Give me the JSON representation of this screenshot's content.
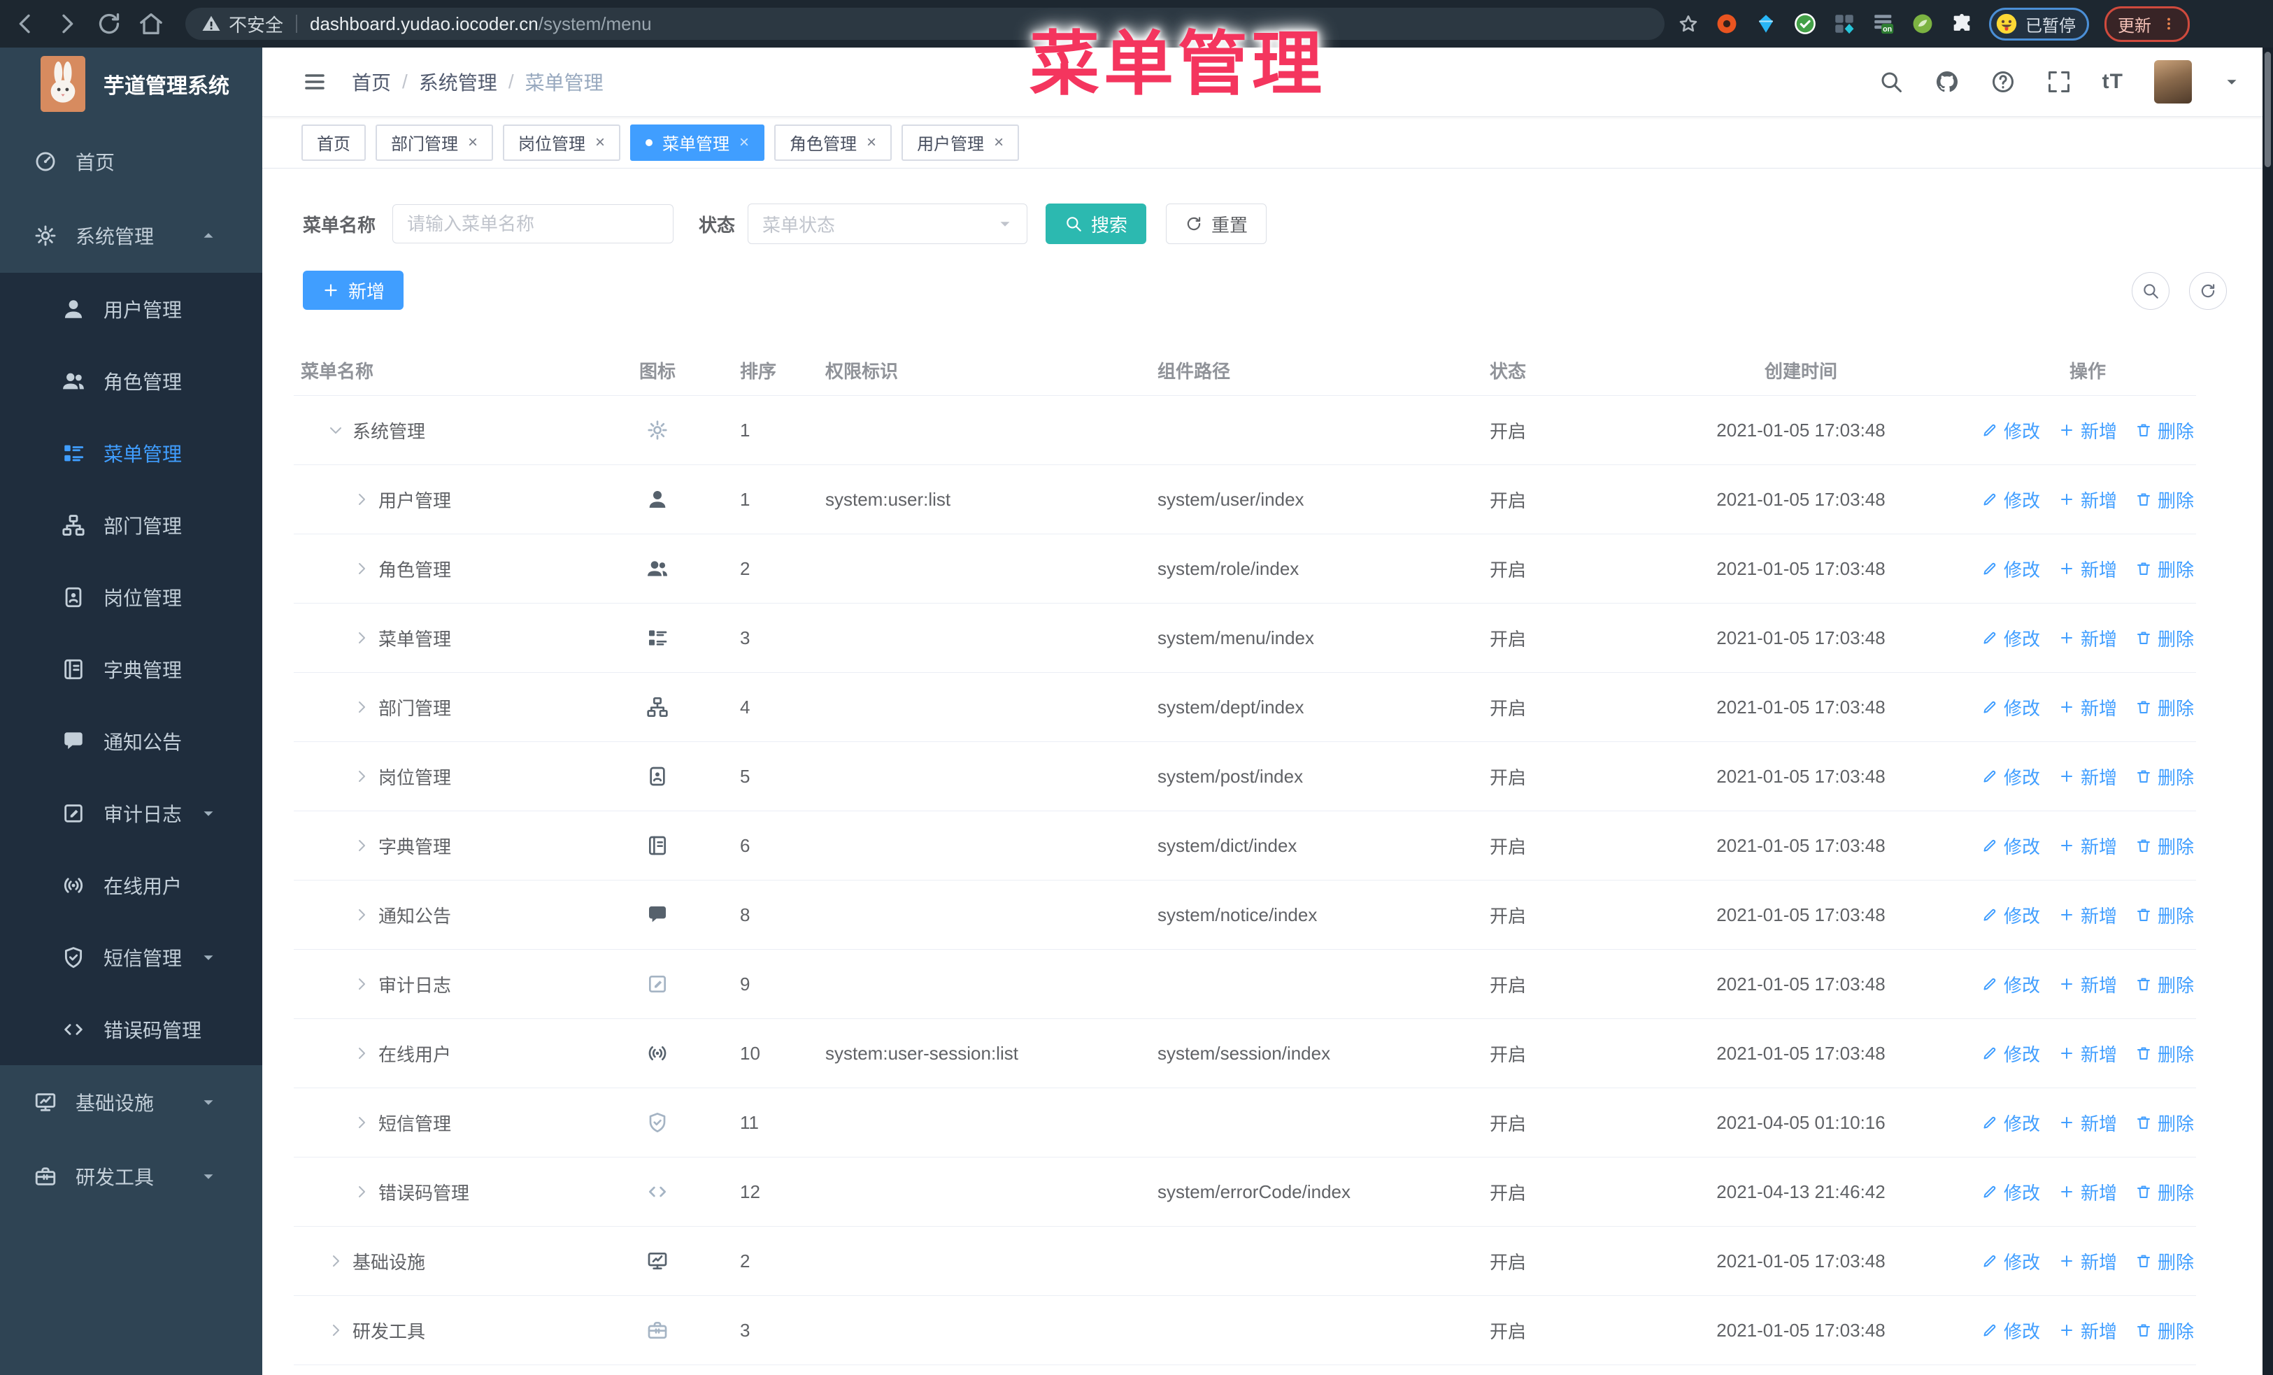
{
  "colors": {
    "primary": "#409EFF",
    "teal": "#2cb9b0",
    "pink": "#f4355e"
  },
  "overlay": {
    "title": "菜单管理"
  },
  "browser": {
    "security_label": "不安全",
    "url_host": "dashboard.yudao.iocoder.cn",
    "url_path": "/system/menu",
    "paused_badge_label": "已暂停",
    "update_button_label": "更新"
  },
  "sidebar": {
    "logo_title": "芋道管理系统",
    "items": [
      {
        "label": "首页",
        "icon": "home",
        "level": 0
      },
      {
        "label": "系统管理",
        "icon": "gear",
        "level": 0,
        "arrow": "up"
      },
      {
        "label": "用户管理",
        "icon": "user",
        "level": 1
      },
      {
        "label": "角色管理",
        "icon": "users",
        "level": 1
      },
      {
        "label": "菜单管理",
        "icon": "tree-table",
        "level": 1,
        "active": true
      },
      {
        "label": "部门管理",
        "icon": "org-tree",
        "level": 1
      },
      {
        "label": "岗位管理",
        "icon": "badge",
        "level": 1
      },
      {
        "label": "字典管理",
        "icon": "dict-book",
        "level": 1
      },
      {
        "label": "通知公告",
        "icon": "message",
        "level": 1
      },
      {
        "label": "审计日志",
        "icon": "log-edit",
        "level": 1,
        "arrow": "down"
      },
      {
        "label": "在线用户",
        "icon": "online",
        "level": 1
      },
      {
        "label": "短信管理",
        "icon": "shield-check",
        "level": 1,
        "arrow": "down"
      },
      {
        "label": "错误码管理",
        "icon": "code",
        "level": 1
      },
      {
        "label": "基础设施",
        "icon": "monitor",
        "level": 0,
        "arrow": "down"
      },
      {
        "label": "研发工具",
        "icon": "toolbox",
        "level": 0,
        "arrow": "down"
      }
    ]
  },
  "header": {
    "breadcrumb": [
      "首页",
      "系统管理",
      "菜单管理"
    ]
  },
  "tabs": [
    {
      "label": "首页",
      "closable": false,
      "active": false
    },
    {
      "label": "部门管理",
      "closable": true,
      "active": false
    },
    {
      "label": "岗位管理",
      "closable": true,
      "active": false
    },
    {
      "label": "菜单管理",
      "closable": true,
      "active": true
    },
    {
      "label": "角色管理",
      "closable": true,
      "active": false
    },
    {
      "label": "用户管理",
      "closable": true,
      "active": false
    }
  ],
  "filters": {
    "name_label": "菜单名称",
    "name_placeholder": "请输入菜单名称",
    "name_value": "",
    "status_label": "状态",
    "status_placeholder": "菜单状态",
    "search_label": "搜索",
    "reset_label": "重置"
  },
  "toolbar": {
    "add_label": "新增"
  },
  "table": {
    "columns": [
      "菜单名称",
      "图标",
      "排序",
      "权限标识",
      "组件路径",
      "状态",
      "创建时间",
      "操作"
    ],
    "op_edit": "修改",
    "op_add": "新增",
    "op_delete": "删除",
    "rows": [
      {
        "name": "系统管理",
        "icon": "gear",
        "icon_style": "lite",
        "level": 0,
        "expanded": true,
        "sort": "1",
        "perm": "",
        "path": "",
        "status": "开启",
        "time": "2021-01-05 17:03:48"
      },
      {
        "name": "用户管理",
        "icon": "user",
        "icon_style": "",
        "level": 1,
        "expanded": false,
        "sort": "1",
        "perm": "system:user:list",
        "path": "system/user/index",
        "status": "开启",
        "time": "2021-01-05 17:03:48"
      },
      {
        "name": "角色管理",
        "icon": "users",
        "icon_style": "",
        "level": 1,
        "expanded": false,
        "sort": "2",
        "perm": "",
        "path": "system/role/index",
        "status": "开启",
        "time": "2021-01-05 17:03:48"
      },
      {
        "name": "菜单管理",
        "icon": "tree-table",
        "icon_style": "",
        "level": 1,
        "expanded": false,
        "sort": "3",
        "perm": "",
        "path": "system/menu/index",
        "status": "开启",
        "time": "2021-01-05 17:03:48"
      },
      {
        "name": "部门管理",
        "icon": "org-tree",
        "icon_style": "",
        "level": 1,
        "expanded": false,
        "sort": "4",
        "perm": "",
        "path": "system/dept/index",
        "status": "开启",
        "time": "2021-01-05 17:03:48"
      },
      {
        "name": "岗位管理",
        "icon": "badge",
        "icon_style": "",
        "level": 1,
        "expanded": false,
        "sort": "5",
        "perm": "",
        "path": "system/post/index",
        "status": "开启",
        "time": "2021-01-05 17:03:48"
      },
      {
        "name": "字典管理",
        "icon": "dict-book",
        "icon_style": "",
        "level": 1,
        "expanded": false,
        "sort": "6",
        "perm": "",
        "path": "system/dict/index",
        "status": "开启",
        "time": "2021-01-05 17:03:48"
      },
      {
        "name": "通知公告",
        "icon": "message",
        "icon_style": "",
        "level": 1,
        "expanded": false,
        "sort": "8",
        "perm": "",
        "path": "system/notice/index",
        "status": "开启",
        "time": "2021-01-05 17:03:48"
      },
      {
        "name": "审计日志",
        "icon": "log-edit",
        "icon_style": "lite",
        "level": 1,
        "expanded": false,
        "sort": "9",
        "perm": "",
        "path": "",
        "status": "开启",
        "time": "2021-01-05 17:03:48"
      },
      {
        "name": "在线用户",
        "icon": "online",
        "icon_style": "",
        "level": 1,
        "expanded": false,
        "sort": "10",
        "perm": "system:user-session:list",
        "path": "system/session/index",
        "status": "开启",
        "time": "2021-01-05 17:03:48"
      },
      {
        "name": "短信管理",
        "icon": "shield-check",
        "icon_style": "lite",
        "level": 1,
        "expanded": false,
        "sort": "11",
        "perm": "",
        "path": "",
        "status": "开启",
        "time": "2021-04-05 01:10:16"
      },
      {
        "name": "错误码管理",
        "icon": "code",
        "icon_style": "lite",
        "level": 1,
        "expanded": false,
        "sort": "12",
        "perm": "",
        "path": "system/errorCode/index",
        "status": "开启",
        "time": "2021-04-13 21:46:42"
      },
      {
        "name": "基础设施",
        "icon": "monitor",
        "icon_style": "",
        "level": 0,
        "expanded": false,
        "sort": "2",
        "perm": "",
        "path": "",
        "status": "开启",
        "time": "2021-01-05 17:03:48"
      },
      {
        "name": "研发工具",
        "icon": "toolbox",
        "icon_style": "lite",
        "level": 0,
        "expanded": false,
        "sort": "3",
        "perm": "",
        "path": "",
        "status": "开启",
        "time": "2021-01-05 17:03:48"
      }
    ]
  }
}
